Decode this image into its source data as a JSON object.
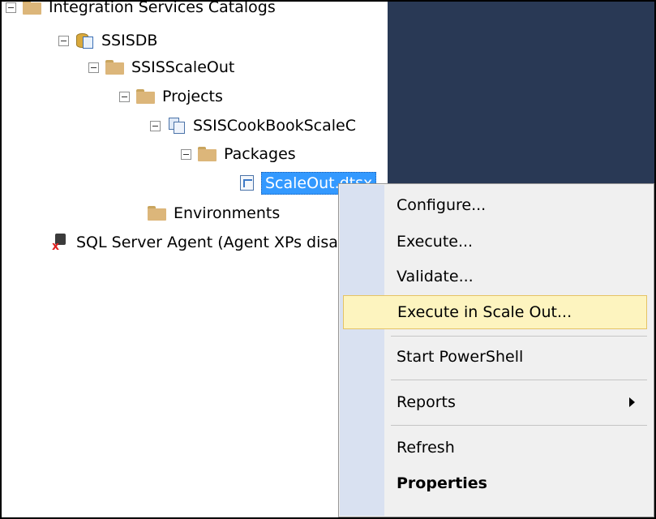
{
  "tree": {
    "root_label": "Integration Services Catalogs",
    "ssisdb_label": "SSISDB",
    "folder_label": "SSISScaleOut",
    "projects_label": "Projects",
    "project_label": "SSISCookBookScaleC",
    "packages_label": "Packages",
    "package_label": "ScaleOut.dtsx",
    "environments_label": "Environments",
    "agent_label": "SQL Server Agent (Agent XPs disabled)"
  },
  "context_menu": {
    "configure": "Configure...",
    "execute": "Execute...",
    "validate": "Validate...",
    "execute_scale_out": "Execute in Scale Out...",
    "start_powershell": "Start PowerShell",
    "reports": "Reports",
    "refresh": "Refresh",
    "properties": "Properties"
  }
}
